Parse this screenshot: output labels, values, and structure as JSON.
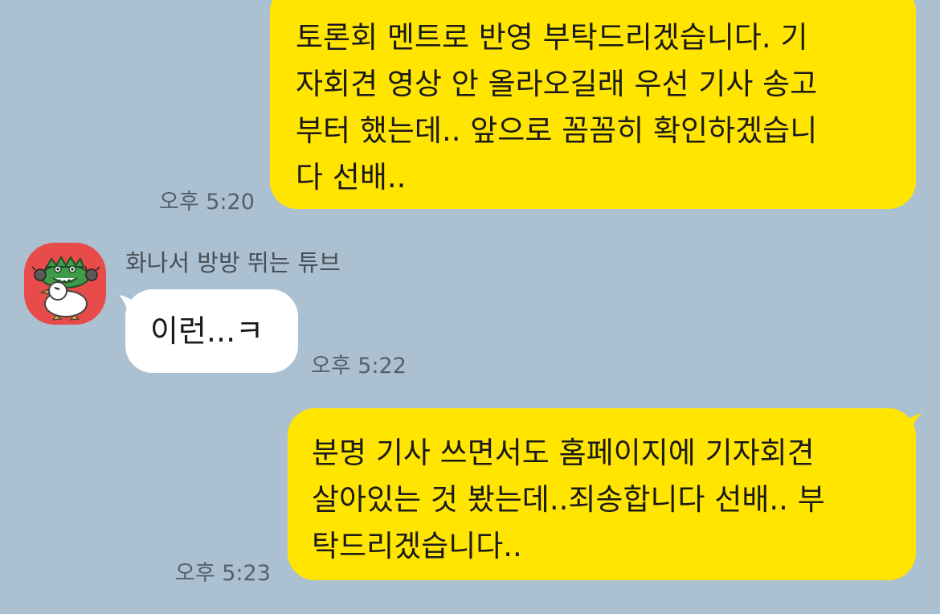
{
  "messages": [
    {
      "direction": "sent",
      "text": "토론회 멘트로 반영 부탁드리겠습니다. 기\n자회견 영상 안 올라오길래 우선 기사 송고\n부터 했는데.. 앞으로 꼼꼼히 확인하겠습니\n다 선배..",
      "time": "오후 5:20"
    },
    {
      "direction": "received",
      "sender": "화나서 방방 뛰는 튜브",
      "avatar_icon": "angry-duck-tube-avatar",
      "text": "이런...ㅋ",
      "time": "오후 5:22"
    },
    {
      "direction": "sent",
      "text": "분명 기사 쓰면서도 홈페이지에 기자회견\n살아있는 것 봤는데..죄송합니다 선배.. 부\n탁드리겠습니다..",
      "time": "오후 5:23"
    }
  ],
  "colors": {
    "background": "#abc1d1",
    "sent_bubble": "#ffe500",
    "received_bubble": "#ffffff",
    "avatar_bg": "#e84c4a"
  }
}
